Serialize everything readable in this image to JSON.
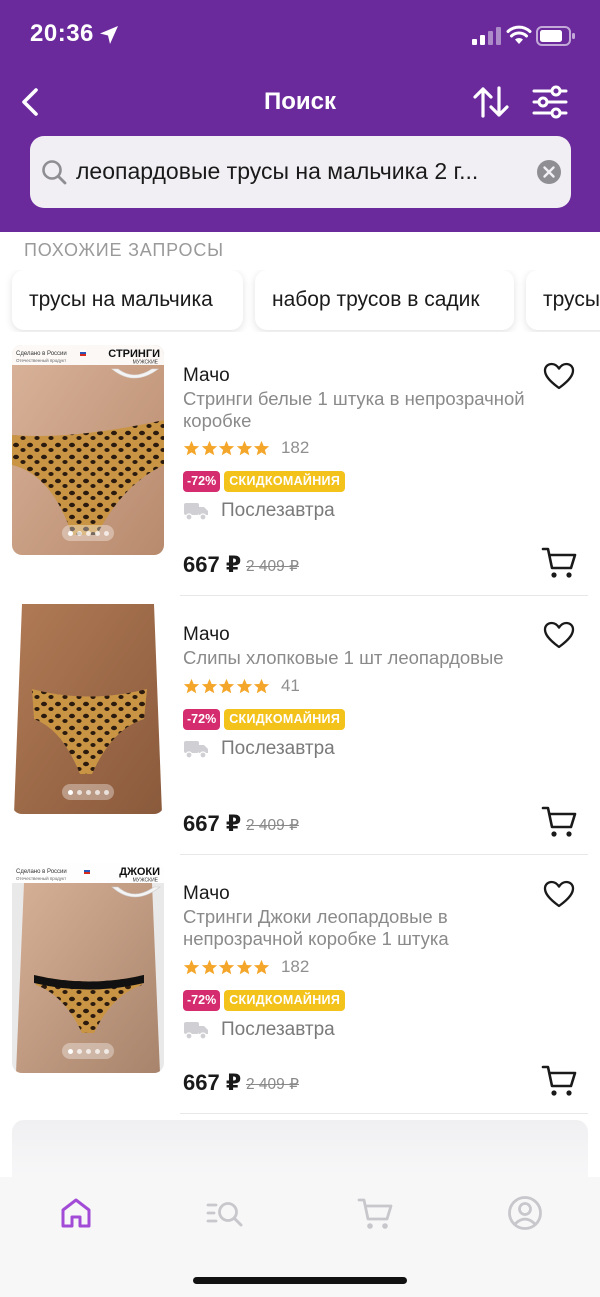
{
  "status_bar": {
    "time": "20:36"
  },
  "nav": {
    "title": "Поиск"
  },
  "search": {
    "query": "леопардовые трусы на мальчика 2 г..."
  },
  "similar": {
    "title": "ПОХОЖИЕ ЗАПРОСЫ",
    "chips": [
      "трусы на мальчика",
      "набор трусов в садик",
      "трусы"
    ]
  },
  "products": [
    {
      "brand": "Мачо",
      "name": "Стринги белые 1 штука в непрозрачной коробке",
      "rating": 5,
      "reviews": "182",
      "discount": "-72%",
      "promo": "СКИДКОМАЙНИЯ",
      "delivery": "Послезавтра",
      "price": "667 ₽",
      "old_price": "2 409 ₽",
      "image_label": "СТРИНГИ",
      "image_sub": "МУЖСКИЕ",
      "image_made": "Сделано в России",
      "image_made_sub": "Отечественный продукт"
    },
    {
      "brand": "Мачо",
      "name": "Слипы хлопковые 1 шт леопардовые",
      "rating": 5,
      "reviews": "41",
      "discount": "-72%",
      "promo": "СКИДКОМАЙНИЯ",
      "delivery": "Послезавтра",
      "price": "667 ₽",
      "old_price": "2 409 ₽"
    },
    {
      "brand": "Мачо",
      "name": "Стринги Джоки леопардовые в непрозрачной коробке 1 штука",
      "rating": 5,
      "reviews": "182",
      "discount": "-72%",
      "promo": "СКИДКОМАЙНИЯ",
      "delivery": "Послезавтра",
      "price": "667 ₽",
      "old_price": "2 409 ₽",
      "image_label": "ДЖОКИ",
      "image_sub": "МУЖСКИЕ",
      "image_made": "Сделано в России",
      "image_made_sub": "Отечественный продукт"
    }
  ],
  "tabbar": {
    "tabs": [
      {
        "icon": "home-icon",
        "active": true
      },
      {
        "icon": "catalog-search-icon",
        "active": false
      },
      {
        "icon": "cart-icon",
        "active": false
      },
      {
        "icon": "profile-icon",
        "active": false
      }
    ]
  },
  "colors": {
    "brand_purple": "#6a2a9c",
    "tab_active": "#a24bd6",
    "discount": "#d42c6e",
    "promo": "#f3c21b",
    "star": "#f4a62a"
  }
}
